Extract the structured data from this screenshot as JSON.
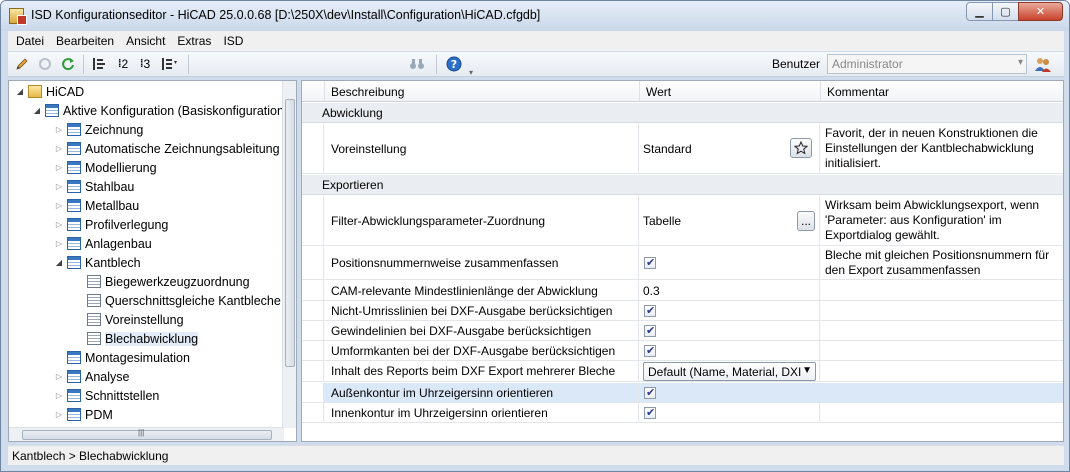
{
  "window": {
    "title": "ISD Konfigurationseditor  -  HiCAD 25.0.0.68 [D:\\250X\\dev\\Install\\Configuration\\HiCAD.cfgdb]"
  },
  "menu": [
    "Datei",
    "Bearbeiten",
    "Ansicht",
    "Extras",
    "ISD"
  ],
  "toolbar": {
    "buttons": [
      "pencil-icon",
      "undo-icon",
      "refresh-icon",
      "level-1-icon",
      "level-2-icon",
      "level-3-icon",
      "level-all-icon",
      "binoculars-icon",
      "help-icon"
    ],
    "level2_label": "2",
    "level3_label": "3",
    "user_label": "Benutzer",
    "user_value": "Administrator"
  },
  "tree": {
    "root": "HiCAD",
    "config": "Aktive Konfiguration (Basiskonfiguration",
    "items": [
      "Zeichnung",
      "Automatische Zeichnungsableitung",
      "Modellierung",
      "Stahlbau",
      "Metallbau",
      "Profilverlegung",
      "Anlagenbau",
      "Kantblech"
    ],
    "kantblech_children": [
      "Biegewerkzeugzuordnung",
      "Querschnittsgleiche Kantbleche",
      "Voreinstellung",
      "Blechabwicklung"
    ],
    "items_after": [
      "Montagesimulation",
      "Analyse",
      "Schnittstellen",
      "PDM"
    ]
  },
  "grid": {
    "headers": {
      "description": "Beschreibung",
      "value": "Wert",
      "comment": "Kommentar"
    },
    "sections": {
      "abwicklung": "Abwicklung",
      "exportieren": "Exportieren"
    },
    "rows": {
      "voreinstellung": {
        "description": "Voreinstellung",
        "value": "Standard",
        "comment": "Favorit, der in neuen Konstruktionen die Einstellungen der Kantblechabwicklung initialisiert."
      },
      "filter": {
        "description": "Filter-Abwicklungsparameter-Zuordnung",
        "value": "Tabelle",
        "button": "...",
        "comment": "Wirksam beim Abwicklungsexport, wenn 'Parameter: aus Konfiguration' im Exportdialog gewählt."
      },
      "positionsnummern": {
        "description": "Positionsnummernweise zusammenfassen",
        "checked": true,
        "comment": "Bleche mit gleichen Positionsnummern für den Export zusammenfassen"
      },
      "cam": {
        "description": "CAM-relevante Mindestlinienlänge der Abwicklung",
        "value": "0.3"
      },
      "umriss": {
        "description": "Nicht-Umrisslinien bei DXF-Ausgabe berücksichtigen",
        "checked": true
      },
      "gewinde": {
        "description": "Gewindelinien bei DXF-Ausgabe berücksichtigen",
        "checked": true
      },
      "umform": {
        "description": "Umformkanten bei der DXF-Ausgabe berücksichtigen",
        "checked": true
      },
      "report": {
        "description": "Inhalt des Reports beim DXF Export mehrerer Bleche",
        "value": "Default (Name, Material, DXI"
      },
      "aussen": {
        "description": "Außenkontur im Uhrzeigersinn orientieren",
        "checked": true
      },
      "innen": {
        "description": "Innenkontur im Uhrzeigersinn orientieren",
        "checked": true
      }
    }
  },
  "statusbar": {
    "path": "Kantblech > Blechabwicklung"
  }
}
